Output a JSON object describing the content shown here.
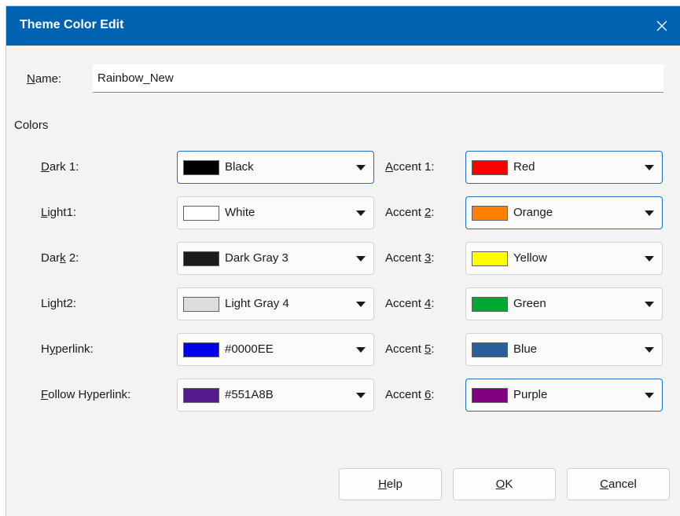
{
  "dialog": {
    "title": "Theme Color Edit",
    "name_label": {
      "ul": "N",
      "rest": "ame:"
    },
    "name_value": "Rainbow_New",
    "colors_section": "Colors"
  },
  "left": [
    {
      "label": {
        "pre": "",
        "ul": "D",
        "post": "ark 1:"
      },
      "value": "Black",
      "swatch": "#000000"
    },
    {
      "label": {
        "pre": "",
        "ul": "L",
        "post": "ight1:"
      },
      "value": "White",
      "swatch": "#ffffff"
    },
    {
      "label": {
        "pre": "Dar",
        "ul": "k",
        "post": " 2:"
      },
      "value": "Dark Gray 3",
      "swatch": "#1c1c1c"
    },
    {
      "label": {
        "pre": "Li",
        "ul": "g",
        "post": "ht2:"
      },
      "value": "Light Gray 4",
      "swatch": "#dddddd"
    },
    {
      "label": {
        "pre": "H",
        "ul": "y",
        "post": "perlink:"
      },
      "value": "#0000EE",
      "swatch": "#0000ee"
    },
    {
      "label": {
        "pre": "",
        "ul": "F",
        "post": "ollow Hyperlink:"
      },
      "value": "#551A8B",
      "swatch": "#551a8b"
    }
  ],
  "right": [
    {
      "label": {
        "pre": "",
        "ul": "A",
        "post": "ccent 1:"
      },
      "value": "Red",
      "swatch": "#ff0000"
    },
    {
      "label": {
        "pre": "Accent ",
        "ul": "2",
        "post": ":"
      },
      "value": "Orange",
      "swatch": "#ff8000"
    },
    {
      "label": {
        "pre": "Accent ",
        "ul": "3",
        "post": ":"
      },
      "value": "Yellow",
      "swatch": "#ffff00"
    },
    {
      "label": {
        "pre": "Accent ",
        "ul": "4",
        "post": ":"
      },
      "value": "Green",
      "swatch": "#00a933"
    },
    {
      "label": {
        "pre": "Accent ",
        "ul": "5",
        "post": ":"
      },
      "value": "Blue",
      "swatch": "#2a6099"
    },
    {
      "label": {
        "pre": "Accent ",
        "ul": "6",
        "post": ":"
      },
      "value": "Purple",
      "swatch": "#800080"
    }
  ],
  "buttons": {
    "help": {
      "ul": "H",
      "rest": "elp"
    },
    "ok": {
      "ul": "O",
      "rest": "K"
    },
    "cancel": {
      "ul": "C",
      "rest": "ancel"
    }
  },
  "colors": {
    "titlebar": "#0063b1",
    "focus_border": "#1b6fc8"
  }
}
